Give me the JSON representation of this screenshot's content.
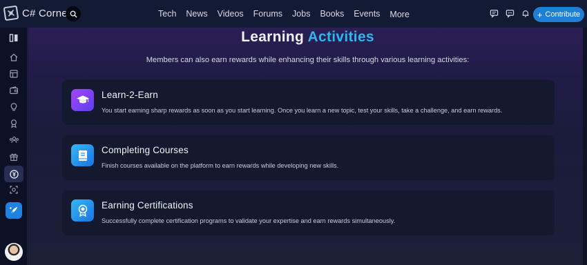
{
  "brand": {
    "name": "C# Corner"
  },
  "nav": {
    "items": [
      "Tech",
      "News",
      "Videos",
      "Forums",
      "Jobs",
      "Books",
      "Events",
      "More"
    ]
  },
  "header": {
    "contribute_label": "Contribute"
  },
  "page": {
    "heading_part1": "Learning",
    "heading_part2": "Activities",
    "subtitle": "Members can also earn rewards while enhancing their skills through various learning activities:"
  },
  "cards": [
    {
      "title": "Learn-2-Earn",
      "description": "You start earning sharp rewards as soon as you start learning. Once you learn a new topic, test your skills, take a challenge, and earn rewards.",
      "icon": "graduation-cap-icon"
    },
    {
      "title": "Completing Courses",
      "description": "Finish courses available on the platform to earn rewards while developing new skills.",
      "icon": "book-icon"
    },
    {
      "title": "Earning Certifications",
      "description": "Successfully complete certification programs to validate your expertise and earn rewards simultaneously.",
      "icon": "certificate-icon"
    }
  ],
  "colors": {
    "accent": "#2cb7ef",
    "contribute_button": "#1f7ed6",
    "icon_purple": "#8a3ff0",
    "icon_blue": "#1f8fe8"
  }
}
